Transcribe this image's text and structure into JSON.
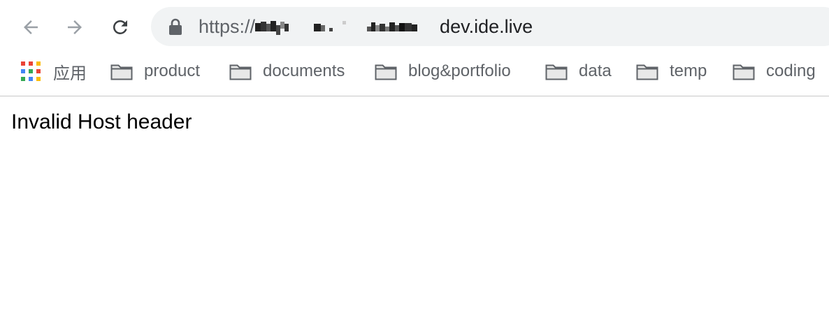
{
  "browser": {
    "url": {
      "scheme": "https://",
      "host_suffix": "dev.ide.live"
    },
    "icons": {
      "back": "arrow-left-icon",
      "forward": "arrow-right-icon",
      "reload": "reload-icon",
      "lock": "lock-icon"
    },
    "colors": {
      "icon_muted": "#9aa0a6",
      "icon": "#3c4043",
      "omnibox_bg": "#f1f3f4",
      "bookmark_text": "#5f6368"
    }
  },
  "bookmarks": {
    "apps_label": "应用",
    "items": [
      "product",
      "documents",
      "blog&portfolio",
      "data",
      "temp",
      "coding"
    ]
  },
  "page": {
    "message": "Invalid Host header"
  }
}
